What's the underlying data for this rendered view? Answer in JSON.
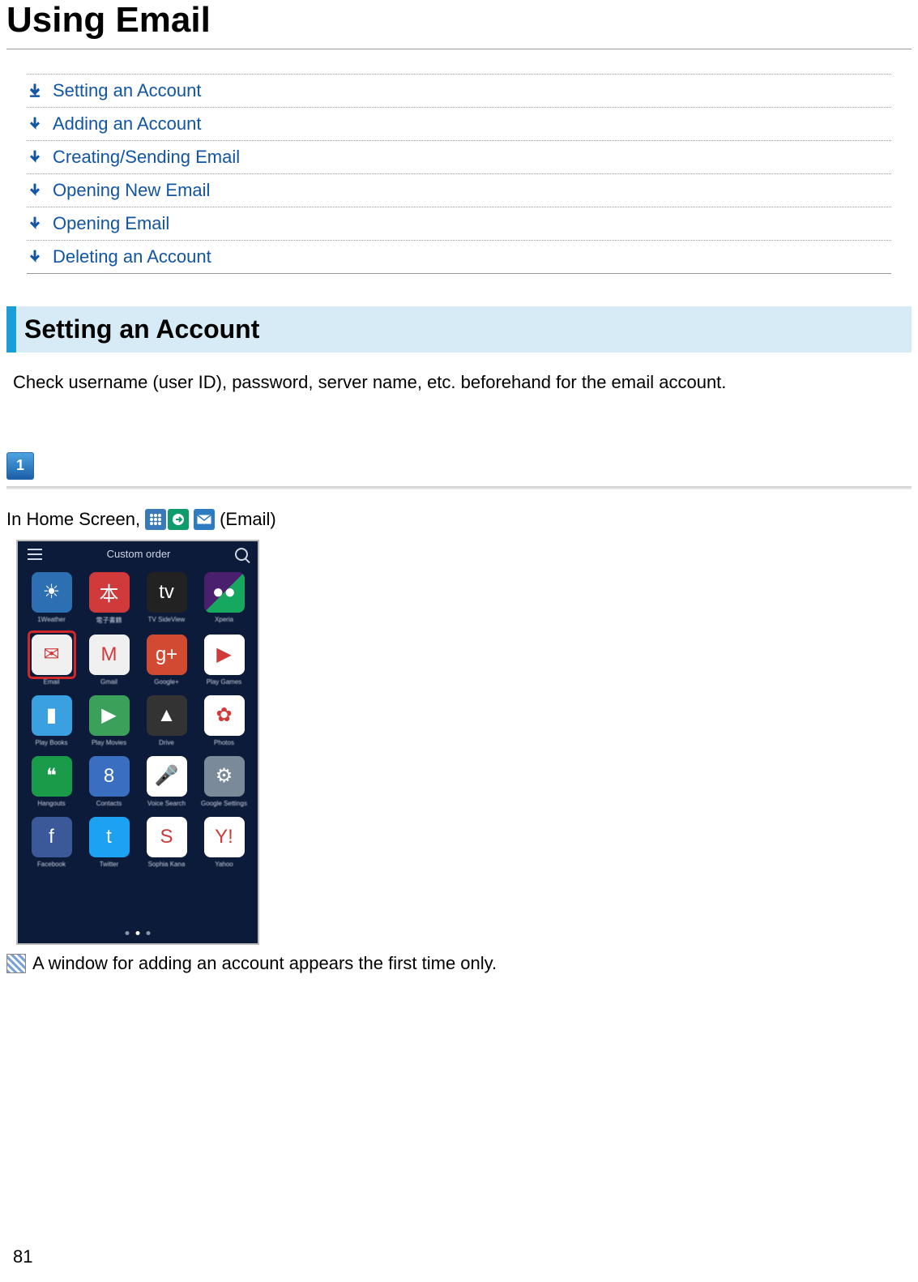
{
  "page": {
    "title": "Using Email",
    "number": "81"
  },
  "toc": [
    {
      "label": "Setting an Account"
    },
    {
      "label": "Adding an Account"
    },
    {
      "label": "Creating/Sending Email"
    },
    {
      "label": "Opening New Email"
    },
    {
      "label": "Opening Email"
    },
    {
      "label": "Deleting an Account"
    }
  ],
  "section": {
    "heading": "Setting an Account",
    "intro": "Check username (user ID), password, server name, etc. beforehand for the email account."
  },
  "step1": {
    "number": "1",
    "instruction_prefix": "In Home Screen,",
    "instruction_suffix": "(Email)",
    "result_note": "A window for adding an account appears the first time only."
  },
  "screenshot": {
    "top_label": "Custom order",
    "apps": [
      {
        "label": "1Weather",
        "bg": "#2c6fb3",
        "glyph": "☀"
      },
      {
        "label": "電子書籍",
        "bg": "#d03a3a",
        "glyph": "本"
      },
      {
        "label": "TV SideView",
        "bg": "#222",
        "glyph": "tv"
      },
      {
        "label": "Xperia",
        "bg": "#4a1f6e,#17a85f",
        "glyph": "●●"
      },
      {
        "label": "Email",
        "bg": "#f0f0f0",
        "glyph": "✉",
        "highlight": true
      },
      {
        "label": "Gmail",
        "bg": "#f0f0f0",
        "glyph": "M"
      },
      {
        "label": "Google+",
        "bg": "#d34a33",
        "glyph": "g+"
      },
      {
        "label": "Play Games",
        "bg": "#fff",
        "glyph": "▶"
      },
      {
        "label": "Play Books",
        "bg": "#3aa0e0",
        "glyph": "▮"
      },
      {
        "label": "Play Movies",
        "bg": "#3aa05a",
        "glyph": "▶"
      },
      {
        "label": "Drive",
        "bg": "#333",
        "glyph": "▲"
      },
      {
        "label": "Photos",
        "bg": "#fff",
        "glyph": "✿"
      },
      {
        "label": "Hangouts",
        "bg": "#1a9b4a",
        "glyph": "❝"
      },
      {
        "label": "Contacts",
        "bg": "#3a6fc0",
        "glyph": "8"
      },
      {
        "label": "Voice Search",
        "bg": "#fff",
        "glyph": "🎤"
      },
      {
        "label": "Google Settings",
        "bg": "#7a8a99",
        "glyph": "⚙"
      },
      {
        "label": "Facebook",
        "bg": "#3b5998",
        "glyph": "f"
      },
      {
        "label": "Twitter",
        "bg": "#1da1f2",
        "glyph": "t"
      },
      {
        "label": "Sophia Kana",
        "bg": "#fff",
        "glyph": "S"
      },
      {
        "label": "Yahoo",
        "bg": "#fff",
        "glyph": "Y!"
      }
    ]
  }
}
